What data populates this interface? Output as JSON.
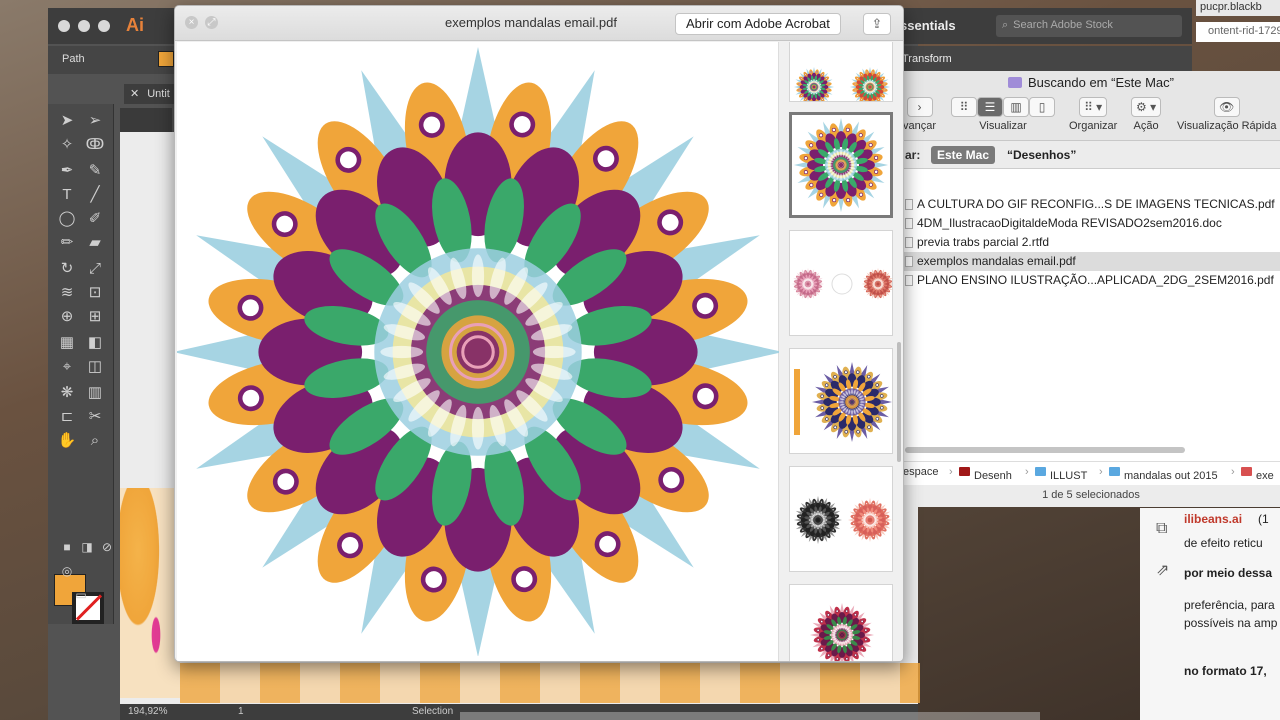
{
  "illustrator": {
    "app_logo": "Ai",
    "control_label": "Path",
    "doc_tab": "Untit",
    "zoom": "194,92%",
    "artboard_num": "1",
    "status_tool": "Selection",
    "workspace": "ssentials",
    "stock_search_placeholder": "Search Adobe Stock",
    "transform_label": "Transform"
  },
  "browser": {
    "tab_title": "pucpr.blackb",
    "url": "ontent-rid-17290",
    "lines": [
      "ilibeans.ai",
      "(1",
      "de efeito reticu",
      "por meio dessa",
      "preferência, para",
      "possíveis na amp",
      "no formato 17,"
    ]
  },
  "quicklook": {
    "title": "exemplos mandalas email.pdf",
    "open_with_label": "Abrir com Adobe Acrobat",
    "share_icon": "share-icon",
    "close_icon": "close-icon",
    "fullscreen_icon": "fullscreen-icon"
  },
  "finder": {
    "window_title": "Buscando em “Este Mac”",
    "toolbar": {
      "back_label": "vançar",
      "view_label": "Visualizar",
      "arrange_label": "Organizar",
      "action_label": "Ação",
      "quicklook_label": "Visualização Rápida"
    },
    "scope": {
      "label": "ar:",
      "selected": "Este Mac",
      "other": "“Desenhos”"
    },
    "files": [
      {
        "name": "A CULTURA DO GIF RECONFIG...S DE IMAGENS TECNICAS.pdf",
        "selected": false
      },
      {
        "name": "4DM_IlustracaoDigitaldeModa REVISADO2sem2016.doc",
        "selected": false
      },
      {
        "name": "previa trabs parcial 2.rtfd",
        "selected": false
      },
      {
        "name": "exemplos mandalas email.pdf",
        "selected": true
      },
      {
        "name": "PLANO ENSINO ILUSTRAÇÃO...APLICADA_2DG_2SEM2016.pdf",
        "selected": false
      }
    ],
    "path": [
      "espace",
      "Desenh",
      "ILLUST",
      "mandalas out 2015",
      "exe"
    ],
    "status": "1 de 5 selecionados"
  },
  "colors": {
    "purple": "#7a1f6e",
    "green": "#3aa86a",
    "light_blue": "#9ccfe0",
    "orange": "#f0a53a",
    "pale_yellow": "#f2e79a",
    "pink": "#e9a0b8"
  }
}
